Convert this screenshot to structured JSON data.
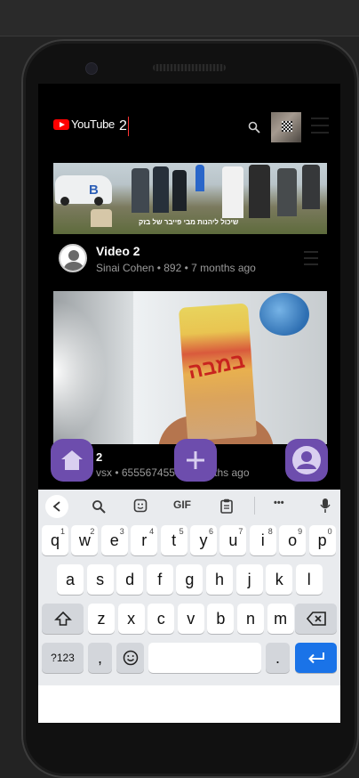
{
  "header": {
    "logo_text": "YouTube",
    "search_value": "2"
  },
  "videos": [
    {
      "thumb_caption": "שיכול ליהנות מבי פייבר של בזק",
      "car_letter": "B",
      "title": "Video 2",
      "subtitle": "Sinai Cohen • 892 • 7 months ago"
    },
    {
      "bag_text": "במבה",
      "title": "2",
      "subtitle": "vsx • 655567455 • 7 months ago"
    }
  ],
  "fabs": {
    "home_icon": "home-icon",
    "add_icon": "plus-icon",
    "profile_icon": "profile-icon"
  },
  "keyboard": {
    "toolbar": {
      "gif": "GIF",
      "more": "•••"
    },
    "row1": [
      {
        "k": "q",
        "n": "1"
      },
      {
        "k": "w",
        "n": "2"
      },
      {
        "k": "e",
        "n": "3"
      },
      {
        "k": "r",
        "n": "4"
      },
      {
        "k": "t",
        "n": "5"
      },
      {
        "k": "y",
        "n": "6"
      },
      {
        "k": "u",
        "n": "7"
      },
      {
        "k": "i",
        "n": "8"
      },
      {
        "k": "o",
        "n": "9"
      },
      {
        "k": "p",
        "n": "0"
      }
    ],
    "row2": [
      "a",
      "s",
      "d",
      "f",
      "g",
      "h",
      "j",
      "k",
      "l"
    ],
    "row3": [
      "z",
      "x",
      "c",
      "v",
      "b",
      "n",
      "m"
    ],
    "sym": "?123",
    "comma": ",",
    "period": "."
  },
  "colors": {
    "fab": "#6d4dad",
    "enter": "#1a73e8",
    "brand": "#ff0000"
  }
}
